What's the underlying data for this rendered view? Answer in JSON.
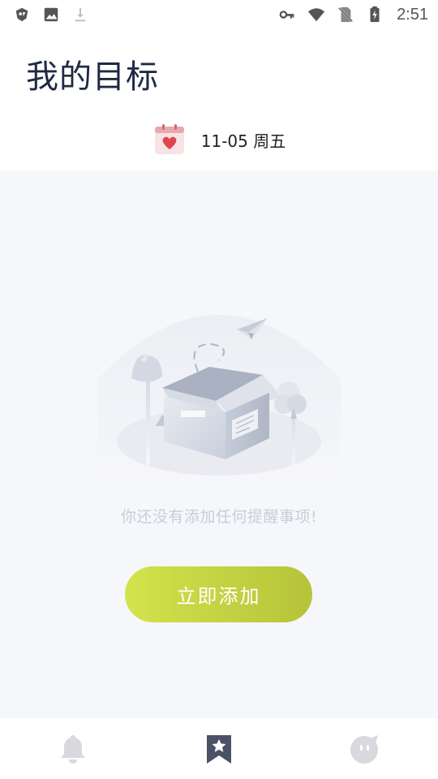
{
  "status_bar": {
    "time": "2:51",
    "left_icons": [
      "app-notification-icon",
      "image-icon",
      "download-icon"
    ],
    "right_icons": [
      "vpn-key-icon",
      "wifi-icon",
      "no-sim-icon",
      "battery-charging-icon"
    ]
  },
  "header": {
    "title": "我的目标"
  },
  "date_bar": {
    "icon": "calendar-heart-icon",
    "date": "11-05 周五"
  },
  "empty_state": {
    "illustration": "empty-box-illustration",
    "message": "你还没有添加任何提醒事项!"
  },
  "add_button": {
    "label": "立即添加",
    "gradient_start": "#d2e34c",
    "gradient_end": "#b6c339"
  },
  "bottom_nav": {
    "items": [
      {
        "icon": "bell-icon",
        "active": false
      },
      {
        "icon": "bookmark-star-icon",
        "active": true
      },
      {
        "icon": "chat-face-icon",
        "active": false
      }
    ]
  },
  "colors": {
    "title": "#1e2a44",
    "content_bg": "#f6f7fb",
    "empty_text": "#c9cdd6",
    "nav_active": "#4a5366",
    "nav_inactive": "#d7d9de",
    "calendar_red": "#e0454f"
  }
}
